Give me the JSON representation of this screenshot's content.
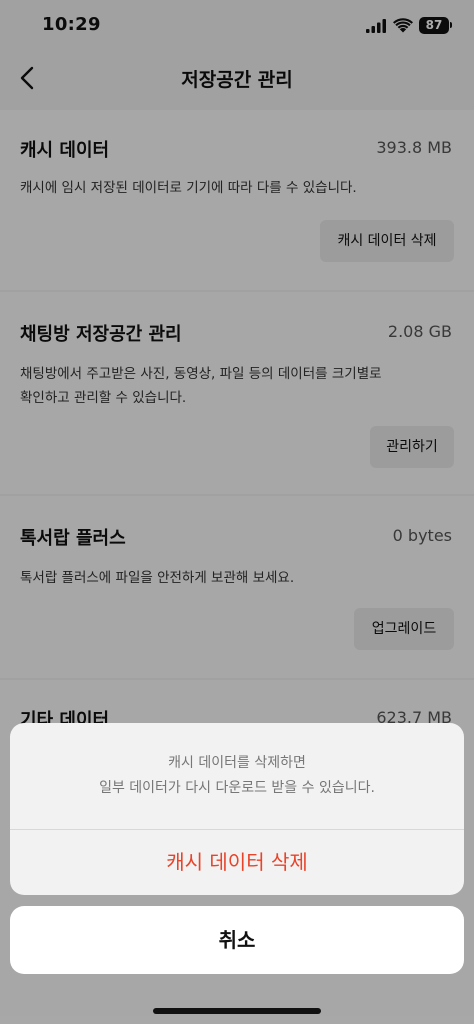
{
  "status_bar": {
    "time": "10:29",
    "battery": "87"
  },
  "header": {
    "title": "저장공간 관리"
  },
  "sections": [
    {
      "title": "캐시 데이터",
      "size": "393.8 MB",
      "description": "캐시에 임시 저장된 데이터로 기기에 따라 다를 수 있습니다.",
      "button": "캐시 데이터 삭제"
    },
    {
      "title": "채팅방 저장공간 관리",
      "size": "2.08 GB",
      "description_line1": "채팅방에서 주고받은 사진, 동영상, 파일 등의 데이터를 크기별로",
      "description_line2": "확인하고 관리할 수 있습니다.",
      "button": "관리하기"
    },
    {
      "title": "톡서랍 플러스",
      "size": "0 bytes",
      "description": "톡서랍 플러스에 파일을 안전하게 보관해 보세요.",
      "button": "업그레이드"
    },
    {
      "title": "기타 데이터",
      "size": "623.7 MB"
    }
  ],
  "action_sheet": {
    "message_line1": "캐시 데이터를 삭제하면",
    "message_line2": "일부 데이터가 다시 다운로드 받을 수 있습니다.",
    "destructive_action": "캐시 데이터 삭제",
    "cancel": "취소"
  },
  "colors": {
    "destructive": "#e8442b",
    "overlay": "rgba(0,0,0,0.33)"
  },
  "icons": {
    "back": "chevron-left-icon",
    "signal": "cellular-signal-icon",
    "wifi": "wifi-icon",
    "battery": "battery-icon"
  }
}
